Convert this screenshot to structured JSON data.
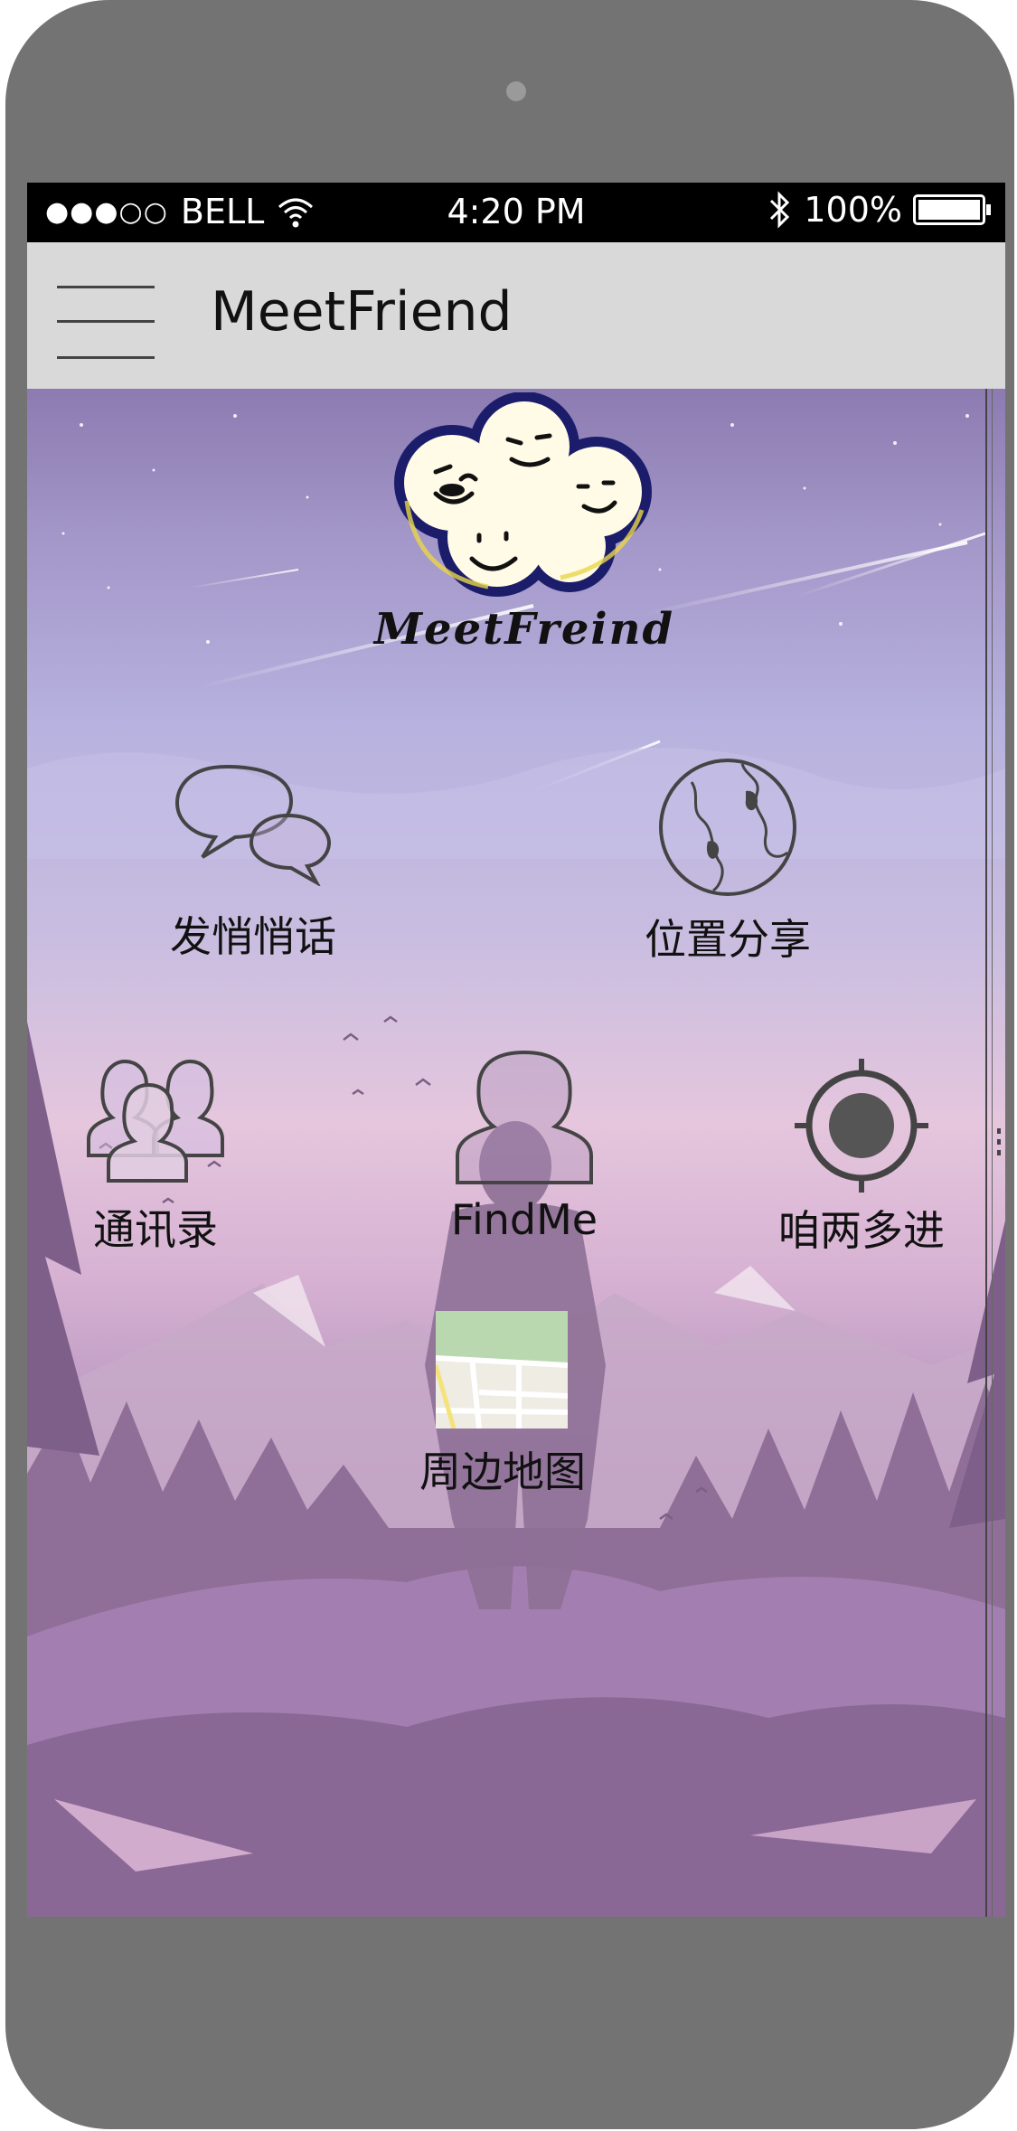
{
  "status_bar": {
    "carrier": "BELL",
    "time": "4:20 PM",
    "battery_percent": "100%",
    "battery_level": 1.0
  },
  "app_bar": {
    "title": "MeetFriend"
  },
  "logo": {
    "text": "MeetFreind"
  },
  "menu": {
    "whisper": "发悄悄话",
    "location_share": "位置分享",
    "contacts": "通讯录",
    "findme": "FindMe",
    "two_of_us": "咱两多进",
    "nearby_map": "周边地图"
  },
  "colors": {
    "phone_body": "#737373",
    "app_bar": "#d9d9d9",
    "icon_stroke": "#444444"
  }
}
